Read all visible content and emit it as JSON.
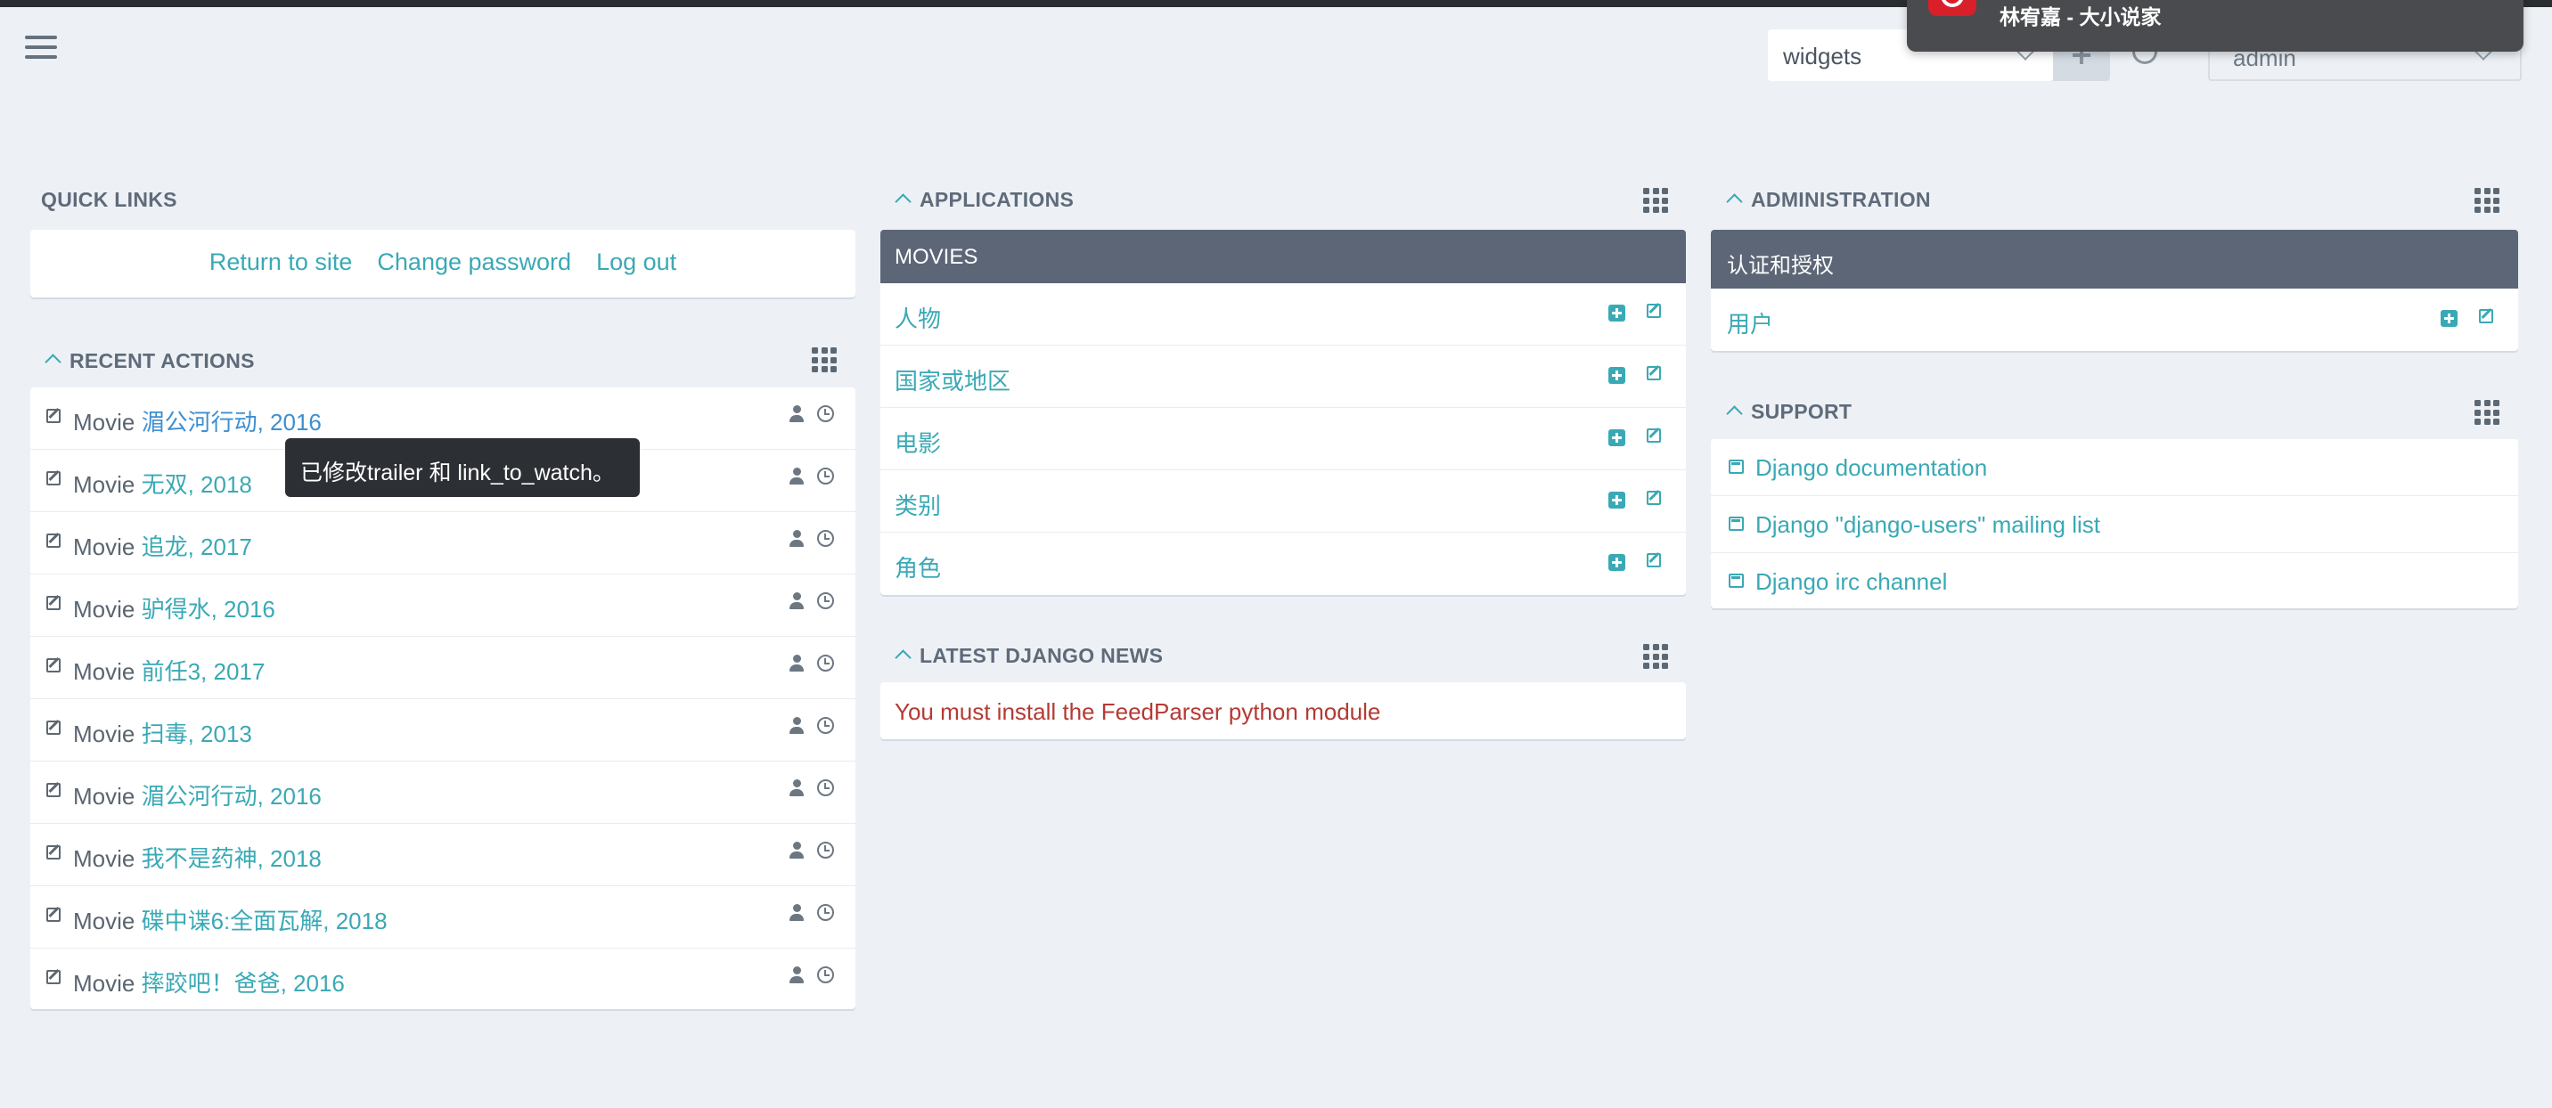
{
  "toolbar": {
    "widget_select_value": "widgets",
    "user_select_value": "admin"
  },
  "notification": {
    "text": "林宥嘉 - 大小说家"
  },
  "quick_links": {
    "title": "QUICK LINKS",
    "links": [
      "Return to site",
      "Change password",
      "Log out"
    ]
  },
  "recent_actions": {
    "title": "RECENT ACTIONS",
    "items": [
      {
        "type": "Movie",
        "object": "湄公河行动, 2016"
      },
      {
        "type": "Movie",
        "object": "无双, 2018"
      },
      {
        "type": "Movie",
        "object": "追龙, 2017"
      },
      {
        "type": "Movie",
        "object": "驴得水, 2016"
      },
      {
        "type": "Movie",
        "object": "前任3, 2017"
      },
      {
        "type": "Movie",
        "object": "扫毒, 2013"
      },
      {
        "type": "Movie",
        "object": "湄公河行动, 2016"
      },
      {
        "type": "Movie",
        "object": "我不是药神, 2018"
      },
      {
        "type": "Movie",
        "object": "碟中谍6:全面瓦解, 2018"
      },
      {
        "type": "Movie",
        "object": "摔跤吧！爸爸, 2016"
      }
    ],
    "tooltip": "已修改trailer 和 link_to_watch。"
  },
  "applications": {
    "title": "APPLICATIONS",
    "app_name": "MOVIES",
    "models": [
      "人物",
      "国家或地区",
      "电影",
      "类别",
      "角色"
    ]
  },
  "administration": {
    "title": "ADMINISTRATION",
    "app_name": "认证和授权",
    "models": [
      "用户"
    ]
  },
  "news": {
    "title": "LATEST DJANGO NEWS",
    "message": "You must install the FeedParser python module"
  },
  "support": {
    "title": "SUPPORT",
    "links": [
      "Django documentation",
      "Django \"django-users\" mailing list",
      "Django irc channel"
    ]
  },
  "colors": {
    "accent": "#3aa9b5",
    "header": "#5c6676",
    "background": "#edf1f5",
    "error": "#b43a34"
  }
}
